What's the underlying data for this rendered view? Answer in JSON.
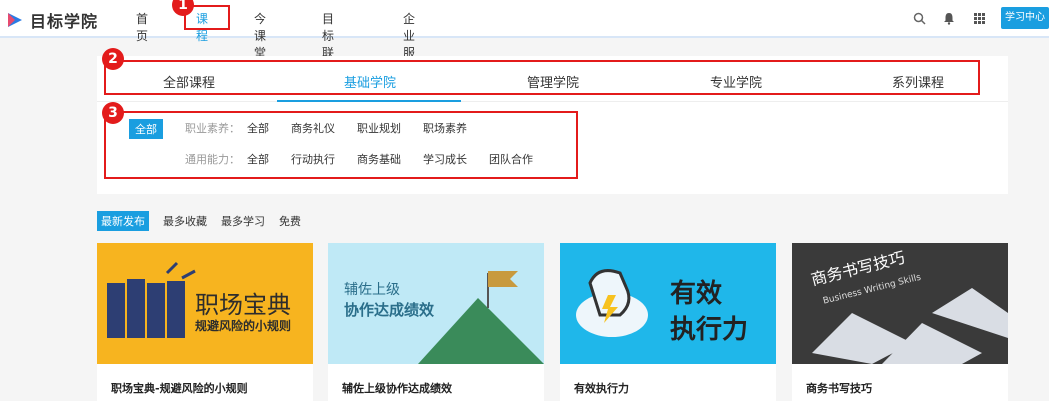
{
  "header": {
    "logo_text": "目标学院",
    "nav": [
      "首页",
      "课程",
      "今课堂",
      "目标联盟",
      "企业服务"
    ],
    "active_nav_index": 1,
    "learn_center": "学习中心"
  },
  "annotations": [
    "1",
    "2",
    "3"
  ],
  "tabs": [
    "全部课程",
    "基础学院",
    "管理学院",
    "专业学院",
    "系列课程"
  ],
  "active_tab_index": 1,
  "filters": {
    "all_label": "全部",
    "rows": [
      {
        "label": "职业素养：",
        "options": [
          "全部",
          "商务礼仪",
          "职业规划",
          "职场素养"
        ]
      },
      {
        "label": "通用能力：",
        "options": [
          "全部",
          "行动执行",
          "商务基础",
          "学习成长",
          "团队合作"
        ]
      }
    ]
  },
  "sort": [
    "最新发布",
    "最多收藏",
    "最多学习",
    "免费"
  ],
  "active_sort_index": 0,
  "cards": [
    {
      "thumb_title": "职场宝典",
      "thumb_subtitle": "规避风险的小规则",
      "title": "职场宝典-规避风险的小规则",
      "bg": "#f7b41f"
    },
    {
      "thumb_title": "辅佐上级",
      "thumb_subtitle": "协作达成绩效",
      "title": "辅佐上级协作达成绩效",
      "bg": "#bfe9f6"
    },
    {
      "thumb_title": "有效",
      "thumb_subtitle": "执行力",
      "title": "有效执行力",
      "bg": "#1fb7ea"
    },
    {
      "thumb_title": "商务书写技巧",
      "thumb_subtitle": "Business Writing Skills",
      "title": "商务书写技巧",
      "bg": "#3a3a3a"
    }
  ],
  "colors": {
    "accent": "#1a9ee0",
    "annotation": "#e31b1b"
  }
}
